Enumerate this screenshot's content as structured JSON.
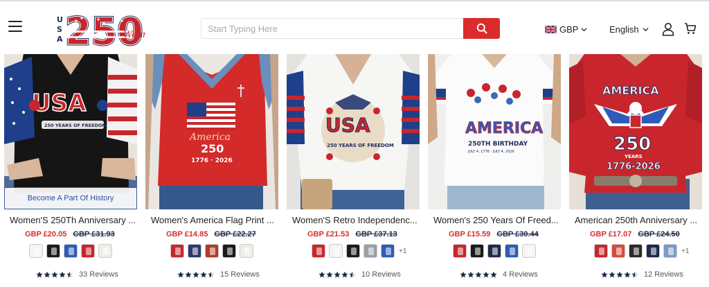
{
  "header": {
    "logo_text": "USA 250",
    "search": {
      "placeholder": "Start Typing Here"
    },
    "currency": "GBP",
    "language": "English"
  },
  "colors": {
    "accent": "#db2b2b",
    "navy": "#1d2a4a",
    "banner_blue": "#2d4f99"
  },
  "icons": [
    "menu-icon",
    "search-icon",
    "uk-flag-icon",
    "chevron-down-icon",
    "user-icon",
    "cart-icon",
    "star-icon"
  ],
  "products": [
    {
      "title": "Women'S 250Th Anniversary ...",
      "price": "GBP £20.05",
      "old_price": "GBP £31.93",
      "banner": "Become A Part Of History",
      "swatches": [
        "#f4f4f4",
        "#1a1a1a",
        "#2e5bb8",
        "#c8262c",
        "#f0ede6"
      ],
      "more": "",
      "rating": 4.5,
      "reviews": "33 Reviews"
    },
    {
      "title": "Women's America Flag Print ...",
      "price": "GBP £14.85",
      "old_price": "GBP £22.27",
      "banner": "",
      "swatches": [
        "#c8262c",
        "#2b3a6b",
        "#b33a2a",
        "#1a1a1a",
        "#f0ede6"
      ],
      "more": "",
      "rating": 4.5,
      "reviews": "15 Reviews"
    },
    {
      "title": "Women'S Retro Independenc...",
      "price": "GBP £21.53",
      "old_price": "GBP £37.13",
      "banner": "",
      "swatches": [
        "#c8262c",
        "#f4f4f4",
        "#1a1a1a",
        "#9aa0a6",
        "#2e5bb8"
      ],
      "more": "+1",
      "rating": 4.5,
      "reviews": "10 Reviews"
    },
    {
      "title": "Women's 250 Years Of Freed...",
      "price": "GBP £15.59",
      "old_price": "GBP £30.44",
      "banner": "",
      "swatches": [
        "#c8262c",
        "#1a1a1a",
        "#1d2a4a",
        "#2e5bb8",
        "#f4f4f4"
      ],
      "more": "",
      "rating": 5,
      "reviews": "4 Reviews"
    },
    {
      "title": "American 250th Anniversary ...",
      "price": "GBP £17.07",
      "old_price": "GBP £24.50",
      "banner": "",
      "swatches": [
        "#c8262c",
        "#d94a3a",
        "#2a2a2a",
        "#1d2a4a",
        "#7a9ac8"
      ],
      "more": "+1",
      "rating": 4.5,
      "reviews": "12 Reviews"
    }
  ]
}
